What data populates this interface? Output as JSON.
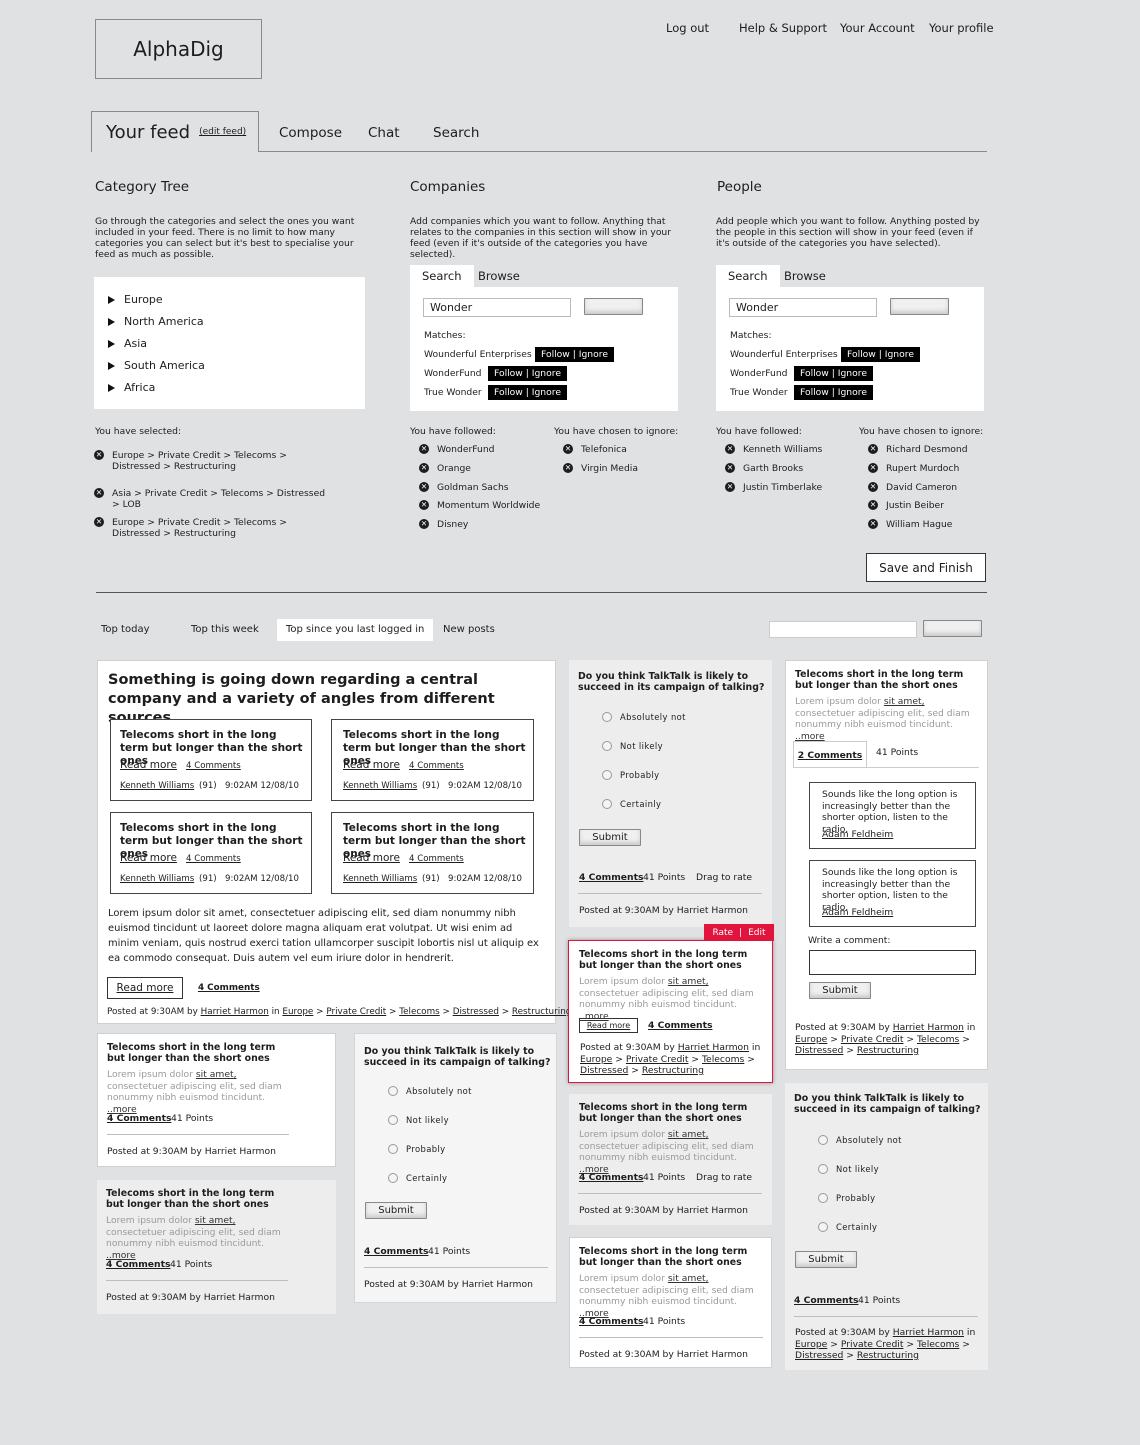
{
  "app": {
    "logo": "AlphaDig"
  },
  "top_nav": [
    "Log out",
    "Help & Support",
    "Your Account",
    "Your profile"
  ],
  "main_tabs": {
    "active": "Your feed",
    "edit": "(edit feed)",
    "others": [
      "Compose",
      "Chat",
      "Search"
    ]
  },
  "category": {
    "title": "Category Tree",
    "desc": "Go through the categories and select the ones you want included in your feed. There is no limit to how many categories you can select but it's best to specialise your feed as much as possible.",
    "items": [
      "Europe",
      "North America",
      "Asia",
      "South America",
      "Africa"
    ],
    "selected_label": "You have selected:",
    "selected": [
      "Europe > Private Credit > Telecoms > Distressed > Restructuring",
      "Asia > Private Credit > Telecoms > Distressed > LOB",
      "Europe > Private Credit > Telecoms > Distressed > Restructuring"
    ]
  },
  "companies": {
    "title": "Companies",
    "desc": "Add companies which you want to follow. Anything that relates to the companies in this section will show in your feed (even if it's outside of the categories you have selected).",
    "tabs": [
      "Search",
      "Browse"
    ],
    "search_value": "Wonder",
    "matches_label": "Matches:",
    "matches": [
      "Wounderful Enterprises",
      "WonderFund",
      "True Wonder"
    ],
    "follow_label": "Follow",
    "ignore_label": "Ignore",
    "followed_label": "You have followed:",
    "followed": [
      "WonderFund",
      "Orange",
      "Goldman Sachs",
      "Momentum Worldwide",
      "Disney"
    ],
    "ignored_label": "You have chosen to ignore:",
    "ignored": [
      "Telefonica",
      "Virgin Media"
    ]
  },
  "people": {
    "title": "People",
    "desc": "Add people which you want to follow. Anything posted by the people in this section will show in your feed (even if it's outside of the categories you have selected).",
    "tabs": [
      "Search",
      "Browse"
    ],
    "search_value": "Wonder",
    "matches_label": "Matches:",
    "matches": [
      "Wounderful Enterprises",
      "WonderFund",
      "True Wonder"
    ],
    "follow_label": "Follow",
    "ignore_label": "Ignore",
    "followed_label": "You have followed:",
    "followed": [
      "Kenneth Williams",
      "Garth Brooks",
      "Justin Timberlake"
    ],
    "ignored_label": "You have chosen to ignore:",
    "ignored": [
      "Richard Desmond",
      "Rupert Murdoch",
      "David Cameron",
      "Justin Beiber",
      "William Hague"
    ]
  },
  "save_button": "Save and Finish",
  "feed_tabs": [
    "Top today",
    "Top this week",
    "Top since you last logged in",
    "New posts"
  ],
  "featured": {
    "title": "Something is going down regarding a central company and a variety of angles from different sources",
    "sub_title": "Telecoms short in the long term but longer than the short ones",
    "read_more": "Read more",
    "comments": "4 Comments",
    "author": "Kenneth Williams",
    "score": "(91)",
    "time": "9:02AM 12/08/10",
    "body": "Lorem ipsum dolor sit amet, consectetuer adipiscing elit, sed diam nonummy nibh euismod tincidunt ut laoreet dolore magna aliquam erat volutpat. Ut wisi enim ad minim veniam, quis nostrud exerci tation ullamcorper suscipit lobortis nisl ut aliquip ex ea commodo consequat. Duis autem vel eum iriure dolor in hendrerit.",
    "posted_prefix": "Posted at 9:30AM by",
    "posted_by": "Harriet Harmon",
    "in": "in",
    "crumbs": [
      "Europe",
      "Private Credit",
      "Telecoms",
      "Distressed",
      "Restructuring"
    ]
  },
  "post": {
    "title": "Telecoms short in the long term but longer than the short ones",
    "excerpt_a": "Lorem ipsum dolor",
    "excerpt_link": "sit amet,",
    "excerpt_b": "consectetuer adipiscing elit, sed diam nonummy nibh euismod tincidunt.",
    "more": "..more",
    "comments": "4 Comments",
    "points": "41 Points",
    "drag": "Drag to rate",
    "posted": "Posted at 9:30AM by Harriet Harmon",
    "posted_prefix": "Posted at 9:30AM by",
    "posted_by": "Harriet Harmon",
    "read_more": "Read more"
  },
  "poll": {
    "question": "Do you think TalkTalk is likely to succeed in its campaign of talking?",
    "options": [
      "Absolutely not",
      "Not likely",
      "Probably",
      "Certainly"
    ],
    "submit": "Submit",
    "comments": "4 Comments",
    "points": "41 Points",
    "drag": "Drag to rate",
    "posted": "Posted at 9:30AM by Harriet Harmon"
  },
  "hover_card": {
    "rate": "Rate",
    "edit": "Edit"
  },
  "comments_card": {
    "tab_comments": "2 Comments",
    "tab_points": "41 Points",
    "comment_text": "Sounds like the long option is increasingly better than the shorter option, listen to the radio.",
    "comment_author": "Adam Feldheim",
    "write_label": "Write a comment:",
    "submit": "Submit"
  }
}
